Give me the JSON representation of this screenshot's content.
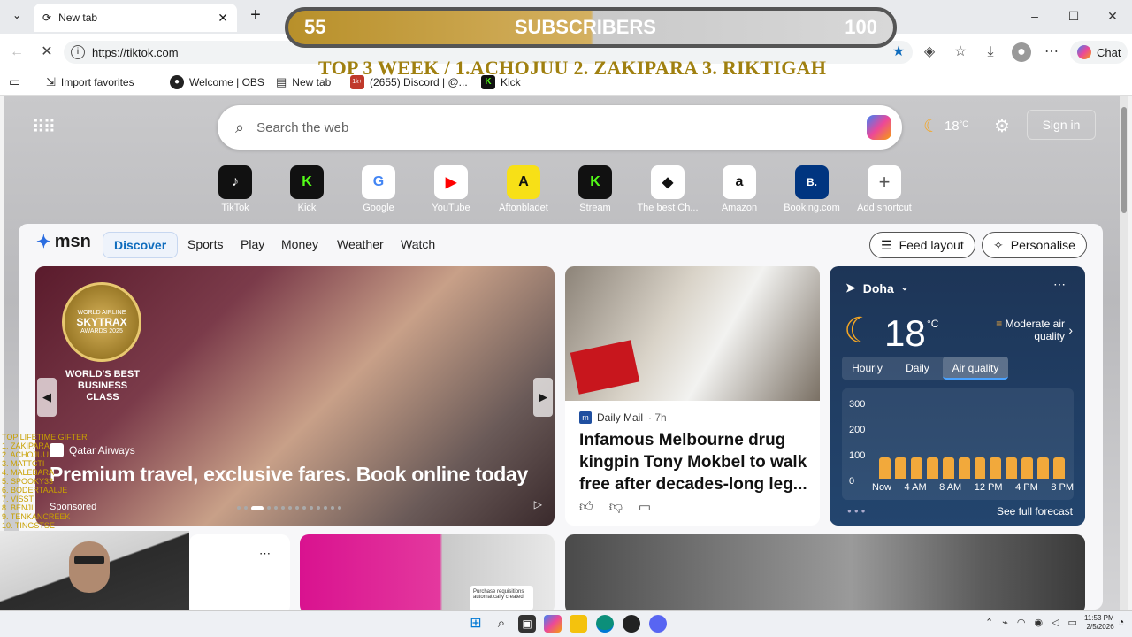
{
  "browser": {
    "tab_title": "New tab",
    "url": "https://tiktok.com",
    "chat_label": "Chat",
    "favorites": [
      {
        "label": "Import favorites"
      },
      {
        "label": "Welcome | OBS"
      },
      {
        "label": "New tab"
      },
      {
        "label": "(2655) Discord | @..."
      },
      {
        "label": "Kick"
      }
    ],
    "discord_badge": "1k+"
  },
  "overlay": {
    "sub_current": "55",
    "sub_label": "SUBSCRIBERS",
    "sub_goal": "100",
    "top3": "TOP 3 WEEK / 1.ACHOJUU 2. ZAKIPARA 3.  RIKTIGAH",
    "gifters": [
      "TOP LIFETIME GIFTER",
      "1. ZAKIPARA",
      "2. ACHOJUU",
      "3. MATTCTI",
      "4. MALEBARA",
      "5. SPOOKY33",
      "6. BODERTAALJE",
      "7. VISST",
      "8. BENJI",
      "9. TENKANCREEK",
      "10. TINGSTSE"
    ]
  },
  "ntp": {
    "search_placeholder": "Search the web",
    "temp": "18",
    "temp_unit": "°C",
    "sign_in": "Sign in",
    "shortcuts": [
      {
        "label": "TikTok",
        "glyph": "♪"
      },
      {
        "label": "Kick",
        "glyph": "K"
      },
      {
        "label": "Google",
        "glyph": "G"
      },
      {
        "label": "YouTube",
        "glyph": "▶"
      },
      {
        "label": "Aftonbladet",
        "glyph": "A"
      },
      {
        "label": "Stream",
        "glyph": "K"
      },
      {
        "label": "The best Ch...",
        "glyph": "◆"
      },
      {
        "label": "Amazon",
        "glyph": "a"
      },
      {
        "label": "Booking.com",
        "glyph": "B."
      },
      {
        "label": "Add shortcut",
        "glyph": "+"
      }
    ]
  },
  "msn": {
    "logo": "msn",
    "tabs": [
      "Discover",
      "Sports",
      "Play",
      "Money",
      "Weather",
      "Watch"
    ],
    "feed_layout": "Feed layout",
    "personalise": "Personalise",
    "hero": {
      "badge_top": "WORLD AIRLINE",
      "badge_brand": "SKYTRAX",
      "badge_bottom": "AWARDS 2025",
      "award_line1": "WORLD'S BEST",
      "award_line2": "BUSINESS CLASS",
      "source": "Qatar Airways",
      "headline": "Premium travel, exclusive fares. Book online today",
      "sponsored": "Sponsored"
    },
    "news": {
      "source": "Daily Mail",
      "age": "· 7h",
      "headline": "Infamous Melbourne drug kingpin Tony Mokbel to walk free after decades-long leg..."
    },
    "weather": {
      "city": "Doha",
      "temp": "18",
      "unit": "°C",
      "air_quality": "Moderate air quality",
      "tabs": [
        "Hourly",
        "Daily",
        "Air quality"
      ],
      "y_ticks": [
        "300",
        "200",
        "100",
        "0"
      ],
      "x_ticks": [
        "Now",
        "4 AM",
        "8 AM",
        "12 PM",
        "4 PM",
        "8 PM"
      ],
      "see_full": "See full forecast"
    },
    "card_label": "Purchase requisitions automatically created"
  },
  "taskbar": {
    "time": "11:53 PM",
    "date": "2/5/2026"
  },
  "colors": {
    "accent": "#0f6cbd",
    "gold": "#a08010",
    "weather_bg": "#1d3557"
  }
}
